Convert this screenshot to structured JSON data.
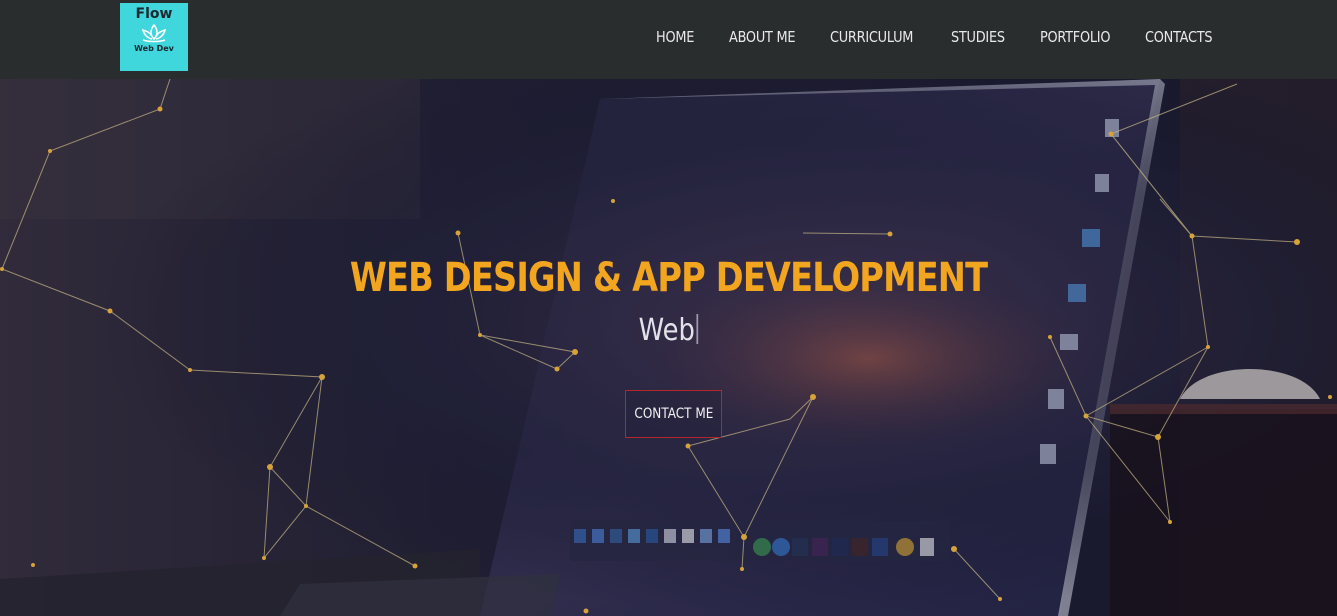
{
  "logo": {
    "top_text": "Flow",
    "bottom_text": "Web Dev",
    "icon": "lotus-icon"
  },
  "nav": {
    "items": [
      {
        "label": "HOME"
      },
      {
        "label": "ABOUT ME"
      },
      {
        "label": "CURRICULUM"
      },
      {
        "label": "STUDIES"
      },
      {
        "label": "PORTFOLIO"
      },
      {
        "label": "CONTACTS"
      }
    ]
  },
  "hero": {
    "title": "WEB DESIGN & APP DEVELOPMENT",
    "subtitle": "Web",
    "cta_label": "CONTACT ME"
  },
  "colors": {
    "navbar": "#2a2d2e",
    "logo_bg": "#3fd6dc",
    "title": "#f2a51f",
    "cta_border": "#b3262a",
    "network_line": "#c9b887",
    "network_node": "#d7a23a"
  }
}
